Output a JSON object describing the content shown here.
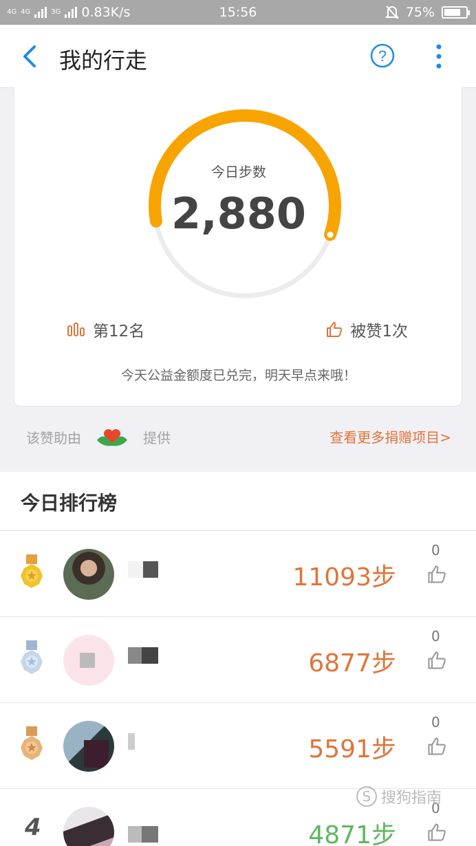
{
  "status_bar": {
    "network_left": "4G",
    "network_right": "4G",
    "network_3g": "3G",
    "speed": "0.83K/s",
    "time": "15:56",
    "battery": "75%",
    "battery_level": 0.75
  },
  "app_bar": {
    "title": "我的行走",
    "back_icon": "chevron-left-icon",
    "help_icon": "question-circle-icon",
    "more_icon": "vertical-dots-icon"
  },
  "summary": {
    "steps_label": "今日步数",
    "steps_value": "2,880",
    "progress": 0.58,
    "rank_text": "第12名",
    "likes_text": "被赞1次",
    "notice": "今天公益金额度已兑完，明天早点来哦！"
  },
  "sponsor": {
    "prefix": "该赞助由",
    "suffix": "提供",
    "more_link": "查看更多捐赠项目>"
  },
  "leaderboard": {
    "title": "今日排行榜",
    "rows": [
      {
        "rank": "",
        "medal": "gold",
        "steps": "11093步",
        "likes": "0"
      },
      {
        "rank": "",
        "medal": "silver",
        "steps": "6877步",
        "likes": "0"
      },
      {
        "rank": "",
        "medal": "bronze",
        "steps": "5591步",
        "likes": "0"
      },
      {
        "rank": "4",
        "medal": "",
        "steps": "4871步",
        "likes": "0"
      }
    ]
  },
  "watermark": {
    "glyph": "S",
    "text": "搜狗指南"
  },
  "colors": {
    "accent": "#1e8be6",
    "orange": "#e0743a",
    "ring": "#f7a400",
    "green": "#5cb85c"
  }
}
